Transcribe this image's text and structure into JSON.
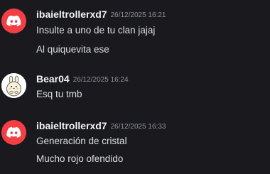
{
  "messages": [
    {
      "username": "ibaieltrollerxd7",
      "timestamp": "26/12/2025 16:21",
      "avatar": "discord-logo-red",
      "lines": [
        "Insulte a uno de tu clan jajaj",
        "Al quiquevita ese"
      ]
    },
    {
      "username": "Bear04",
      "timestamp": "26/12/2025 16:24",
      "avatar": "bear-sticker",
      "lines": [
        "Esq tu tmb"
      ]
    },
    {
      "username": "ibaieltrollerxd7",
      "timestamp": "26/12/2025 16:33",
      "avatar": "discord-logo-red",
      "lines": [
        "Generación de cristal",
        "Mucho rojo ofendido"
      ]
    }
  ],
  "colors": {
    "background": "#1a1a1e",
    "username": "#f2f3f5",
    "timestamp": "#8e9198",
    "text": "#dbdee1",
    "discord_red": "#f23f43"
  }
}
